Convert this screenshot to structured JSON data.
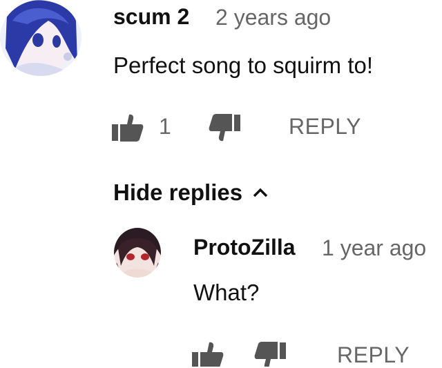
{
  "comment": {
    "author": "scum 2",
    "timestamp": "2 years ago",
    "text": "Perfect song to squirm to!",
    "like_count": "1",
    "reply_label": "REPLY",
    "avatar_icon": "anime-avatar-blue-hair"
  },
  "replies_toggle": {
    "label": "Hide replies",
    "icon": "chevron-up-icon"
  },
  "reply": {
    "author": "ProtoZilla",
    "timestamp": "1 year ago",
    "text": "What?",
    "reply_label": "REPLY",
    "avatar_icon": "anime-avatar-dark-hair"
  },
  "colors": {
    "text": "#111111",
    "muted": "#666666",
    "icon": "#555555",
    "background": "#ffffff"
  }
}
